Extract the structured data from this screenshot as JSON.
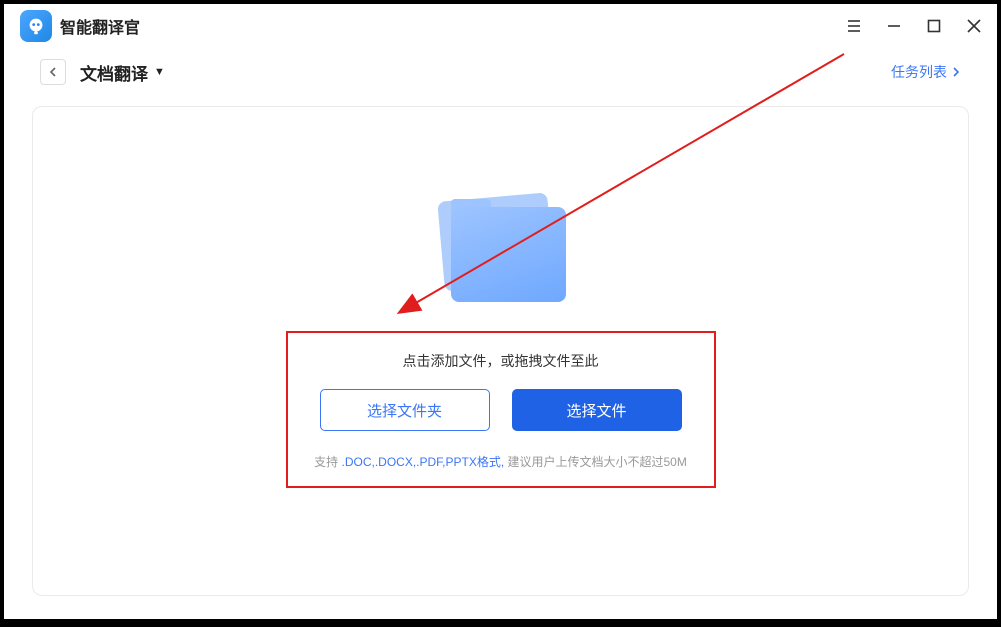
{
  "app": {
    "title": "智能翻译官"
  },
  "header": {
    "page_title": "文档翻译",
    "task_list": "任务列表"
  },
  "drop": {
    "instruction": "点击添加文件，或拖拽文件至此",
    "choose_folder": "选择文件夹",
    "choose_file": "选择文件",
    "support_prefix": "支持 ",
    "support_formats": ".DOC,.DOCX,.PDF,PPTX格式,",
    "support_suffix": " 建议用户上传文档大小不超过50M"
  }
}
